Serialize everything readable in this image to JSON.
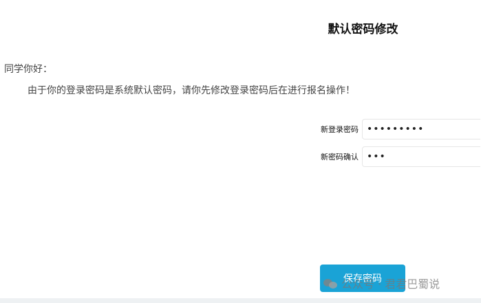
{
  "header": {
    "title": "默认密码修改"
  },
  "notice": {
    "greeting": "同学你好：",
    "message": "由于你的登录密码是系统默认密码，请你先修改登录密码后在进行报名操作！"
  },
  "form": {
    "new_password_label": "新登录密码",
    "new_password_value": "•••••••••",
    "confirm_password_label": "新密码确认",
    "confirm_password_value": "•••"
  },
  "actions": {
    "save_label": "保存密码"
  },
  "watermark": {
    "text": "公众号 · 君君巴蜀说",
    "icon": "wechat-icon"
  }
}
